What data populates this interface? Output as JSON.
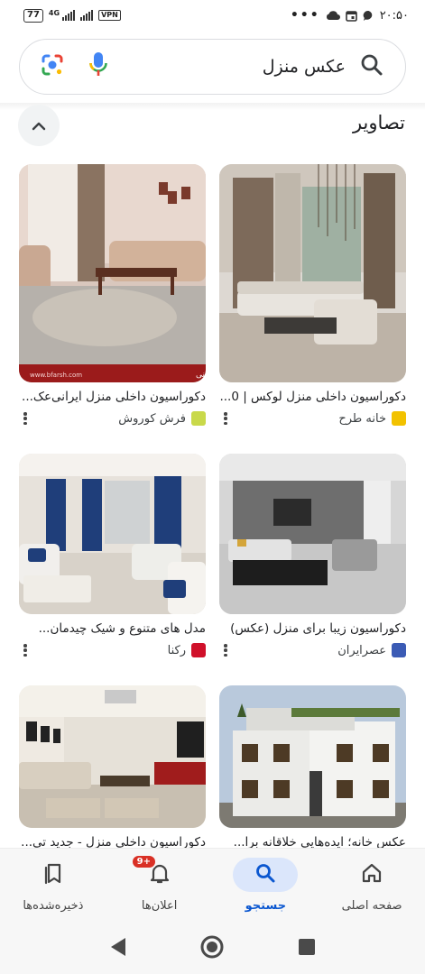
{
  "status_bar": {
    "battery": "77",
    "network": "4G",
    "vpn": "VPN",
    "more": "•••",
    "time": "۲۰:۵۰"
  },
  "search": {
    "query": "عکس منزل",
    "icons": [
      "search-icon",
      "mic-icon",
      "lens-icon"
    ]
  },
  "section": {
    "title": "تصاویر",
    "collapse_icon": "chevron-up-icon"
  },
  "results": [
    {
      "caption": "دکوراسیون داخلی منزل لوکس | 0...",
      "source": "خانه طرح",
      "favicon_color": "#f2c200",
      "watermark": ""
    },
    {
      "caption": "دکوراسیون داخلی منزل ایرانی‌عک...",
      "source": "فرش کوروش",
      "favicon_color": "#c9d94a",
      "watermark": "منزل ایرانی",
      "watermark_url": "www.bfarsh.com"
    },
    {
      "caption": "دکوراسیون زیبا برای منزل (عکس)",
      "source": "عصرایران",
      "favicon_color": "#3b5bb5",
      "watermark": ""
    },
    {
      "caption": "مدل های متنوع و شیک چیدمان...",
      "source": "رکنا",
      "favicon_color": "#d0102a",
      "watermark": ""
    },
    {
      "caption": "عکس خانه؛ ایده‌هایی خلاقانه برا...",
      "source": "",
      "favicon_color": "",
      "watermark": ""
    },
    {
      "caption": "دکوراسیون داخلی منزل - جدید تی...",
      "source": "",
      "favicon_color": "",
      "watermark": ""
    }
  ],
  "bottom_nav": [
    {
      "label": "صفحه اصلی",
      "icon": "home-icon",
      "active": false
    },
    {
      "label": "جستجو",
      "icon": "search-icon",
      "active": true
    },
    {
      "label": "اعلان‌ها",
      "icon": "bell-icon",
      "active": false,
      "badge": "9+"
    },
    {
      "label": "ذخیره‌شده‌ها",
      "icon": "bookmarks-icon",
      "active": false
    }
  ],
  "system_nav": [
    "back-icon",
    "home-circle-icon",
    "recents-icon"
  ],
  "colors": {
    "accent": "#0b57d0",
    "active_pill": "#dbe6fb",
    "badge": "#d93025"
  }
}
